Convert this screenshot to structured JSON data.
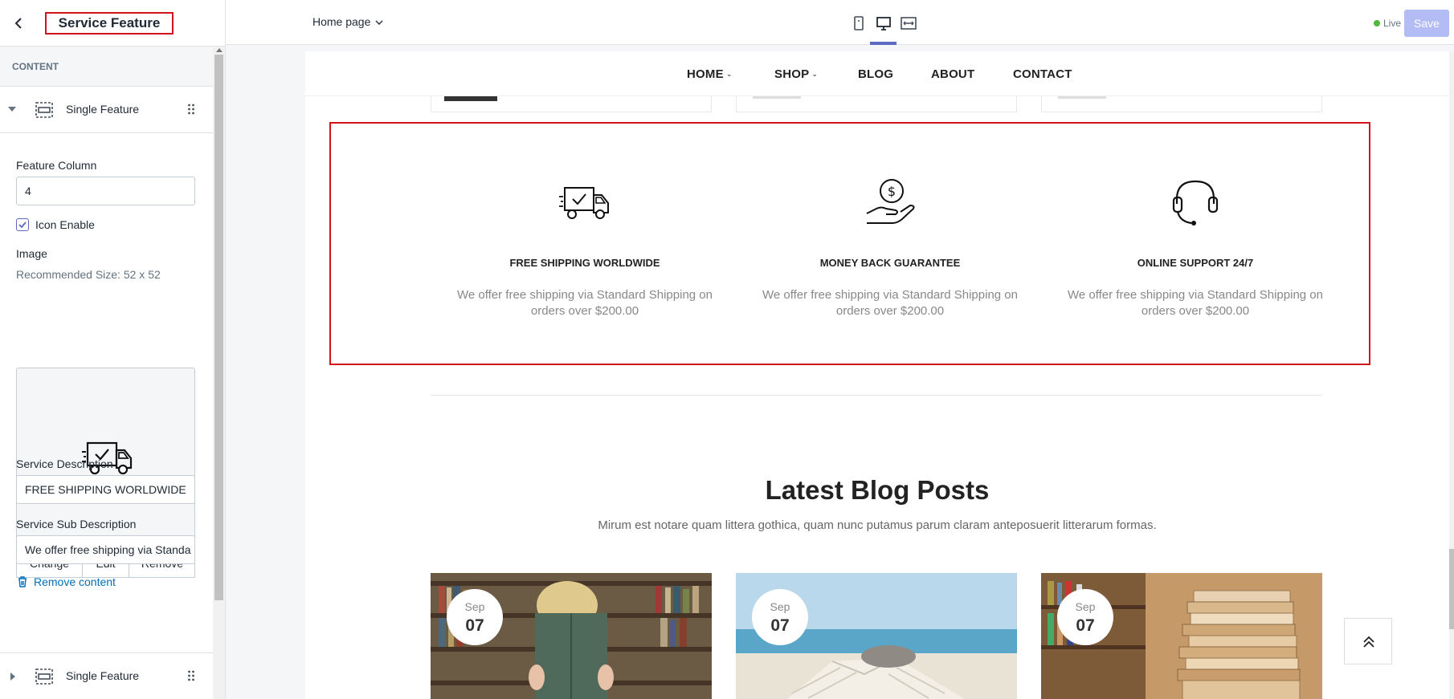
{
  "sidebar": {
    "title": "Service Feature",
    "section_title": "CONTENT",
    "block_label": "Single Feature",
    "block2_label": "Single Feature",
    "feature_column_label": "Feature Column",
    "feature_column_value": "4",
    "icon_enable_label": "Icon Enable",
    "image_label": "Image",
    "image_help": "Recommended Size: 52 x 52",
    "image_actions": [
      "Change",
      "Edit",
      "Remove"
    ],
    "service_desc_label": "Service Description",
    "service_desc_value": "FREE SHIPPING WORLDWIDE",
    "service_sub_label": "Service Sub Description",
    "service_sub_value": "We offer free shipping via Standa",
    "remove_content": "Remove content"
  },
  "topbar": {
    "page": "Home page",
    "live": "Live",
    "save": "Save"
  },
  "preview": {
    "nav": [
      "HOME",
      "SHOP",
      "BLOG",
      "ABOUT",
      "CONTACT"
    ],
    "services": [
      {
        "title": "FREE SHIPPING WORLDWIDE",
        "desc": "We offer free shipping via Standard Shipping on orders over $200.00",
        "icon": "truck-icon"
      },
      {
        "title": "MONEY BACK GUARANTEE",
        "desc": "We offer free shipping via Standard Shipping on orders over $200.00",
        "icon": "money-hand-icon"
      },
      {
        "title": "ONLINE SUPPORT 24/7",
        "desc": "We offer free shipping via Standard Shipping on orders over $200.00",
        "icon": "headset-icon"
      }
    ],
    "blog_title": "Latest Blog Posts",
    "blog_sub": "Mirum est notare quam littera gothica, quam nunc putamus parum claram anteposuerit litterarum formas.",
    "posts": [
      {
        "month": "Sep",
        "day": "07"
      },
      {
        "month": "Sep",
        "day": "07"
      },
      {
        "month": "Sep",
        "day": "07"
      }
    ]
  },
  "colors": {
    "highlight": "#d0141a",
    "accent": "#5c6ac4",
    "link": "#006fbb",
    "live": "#50b83c"
  }
}
